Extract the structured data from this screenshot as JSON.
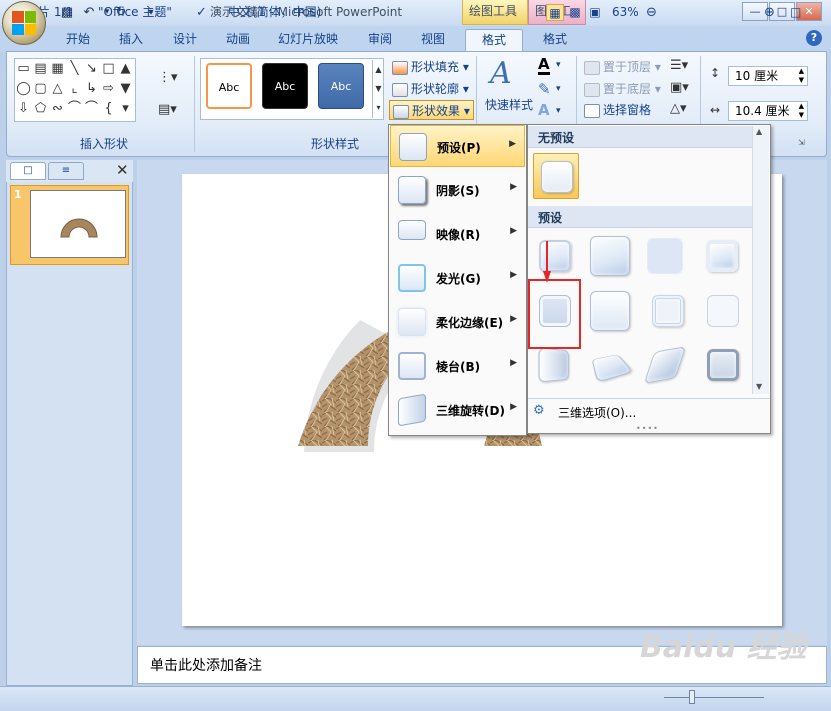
{
  "title": "演示文稿1 - Microsoft PowerPoint",
  "contextual_tabs": [
    "绘图工具",
    "图片工具"
  ],
  "tabs": [
    "开始",
    "插入",
    "设计",
    "动画",
    "幻灯片放映",
    "审阅",
    "视图",
    "格式",
    "格式"
  ],
  "active_tab_index": 7,
  "ribbon": {
    "insert_shapes_label": "插入形状",
    "shape_styles_label": "形状样式",
    "style_samples": [
      "Abc",
      "Abc",
      "Abc"
    ],
    "fill": "形状填充",
    "outline": "形状轮廓",
    "effects": "形状效果",
    "quick_styles": "快速样式",
    "bring_front": "置于顶层",
    "send_back": "置于底层",
    "selection_pane": "选择窗格",
    "height": "10 厘米",
    "width": "10.4 厘米"
  },
  "effects_menu": [
    {
      "label": "预设(P)",
      "icon": "preset-icon"
    },
    {
      "label": "阴影(S)",
      "icon": "shadow-icon"
    },
    {
      "label": "映像(R)",
      "icon": "reflection-icon"
    },
    {
      "label": "发光(G)",
      "icon": "glow-icon"
    },
    {
      "label": "柔化边缘(E)",
      "icon": "soft-edge-icon"
    },
    {
      "label": "棱台(B)",
      "icon": "bevel-icon"
    },
    {
      "label": "三维旋转(D)",
      "icon": "3d-rotation-icon"
    }
  ],
  "gallery": {
    "no_preset_header": "无预设",
    "preset_header": "预设",
    "footer": "三维选项(O)..."
  },
  "slide_number": "1",
  "notes_placeholder": "单击此处添加备注",
  "status": {
    "slide": "幻灯片 1/1",
    "theme": "\"Office 主题\"",
    "language": "中文(简体，中国)",
    "zoom": "63%"
  },
  "watermark": "Baidu 经验",
  "colors": {
    "accent_orange": "#f79646",
    "highlight_red": "#e32626"
  }
}
